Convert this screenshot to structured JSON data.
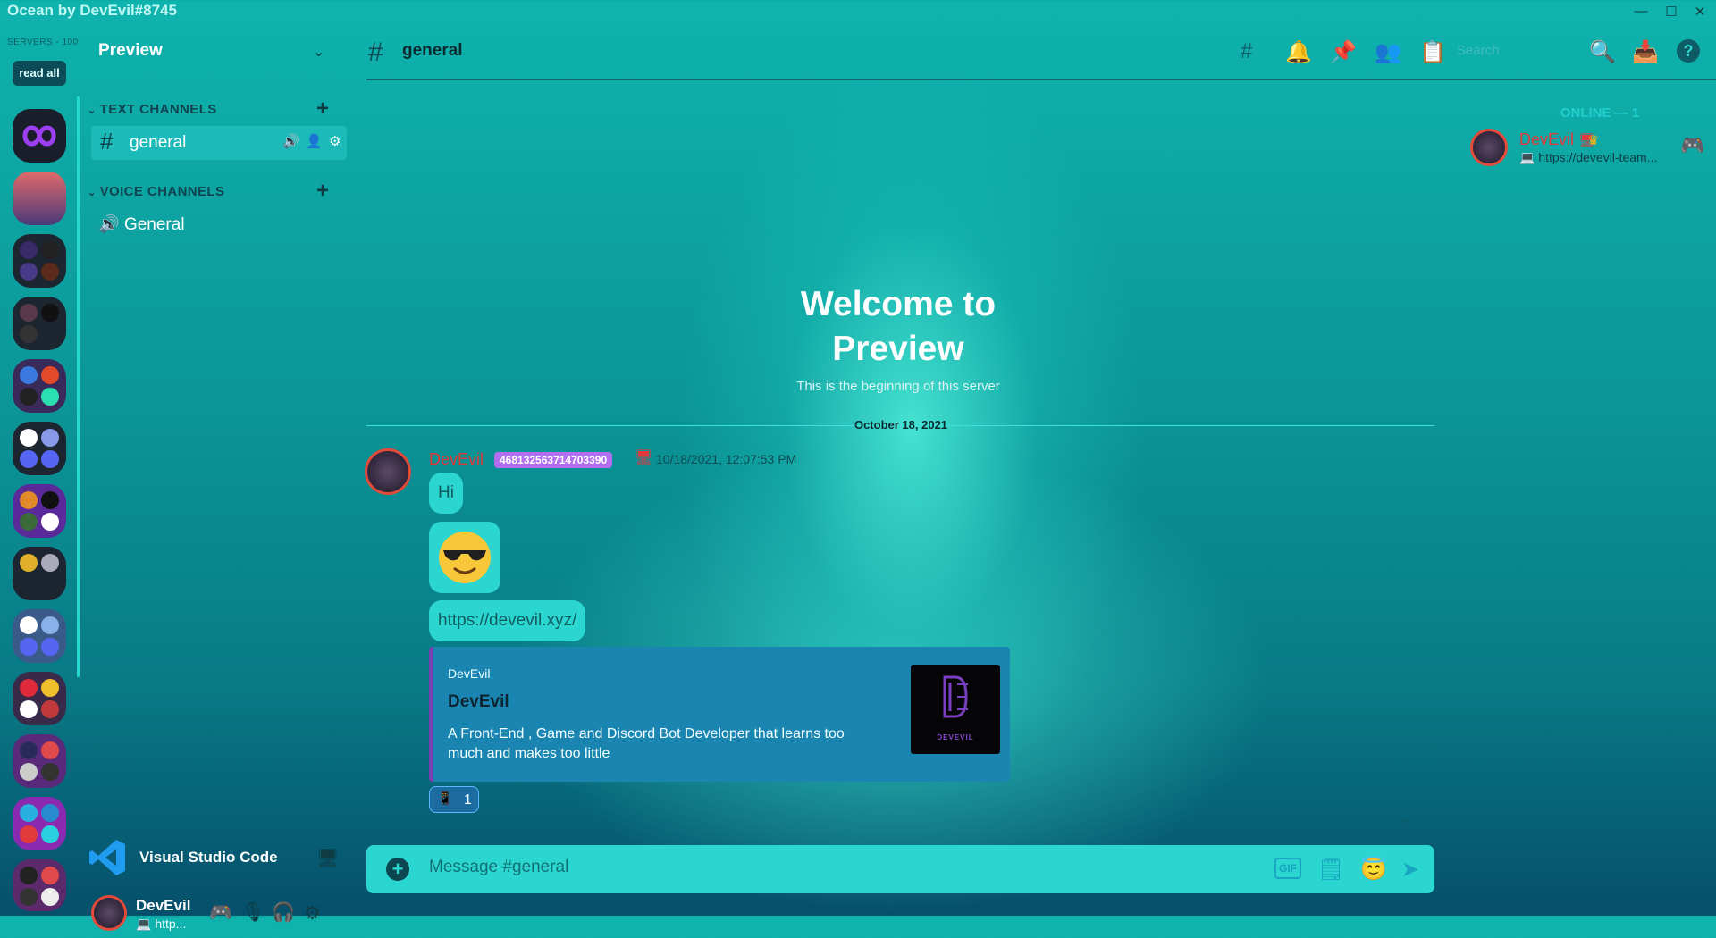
{
  "window": {
    "title": "Ocean by DevEvil#8745",
    "controls": [
      "—",
      "☐",
      "✕"
    ]
  },
  "rail": {
    "servers_count": "SERVERS - 100",
    "read_all": "read all"
  },
  "sidebar": {
    "server_name": "Preview",
    "text_category": "TEXT CHANNELS",
    "voice_category": "VOICE CHANNELS",
    "text_channels": [
      {
        "name": "general"
      }
    ],
    "voice_channels": [
      {
        "name": "General"
      }
    ]
  },
  "activity": {
    "name": "Visual Studio Code"
  },
  "user": {
    "name": "DevEvil",
    "status": "💻 http..."
  },
  "header": {
    "channel": "general",
    "search_placeholder": "Search"
  },
  "welcome": {
    "title_line1": "Welcome to",
    "title_line2": "Preview",
    "subtitle": "This is the beginning of this server"
  },
  "date_divider": "October 18, 2021",
  "message": {
    "author": "DevEvil",
    "badge": "468132563714703390",
    "timestamp": "10/18/2021, 12:07:53 PM",
    "text": "Hi",
    "emoji": "😎",
    "link": "https://devevil.xyz/",
    "embed": {
      "provider": "DevEvil",
      "title": "DevEvil",
      "description": "A Front-End , Game and Discord Bot Developer that learns too much and makes too little",
      "thumb_text": "DEVEVIL"
    },
    "reaction_count": "1"
  },
  "composer": {
    "placeholder": "Message #general",
    "gif_label": "GIF"
  },
  "members": {
    "online_header": "ONLINE — 1",
    "list": [
      {
        "name": "DevEvil",
        "status": "💻 https://devevil-team..."
      }
    ]
  },
  "colors": {
    "accent": "#2ad6cf",
    "author": "#e2383a",
    "badge": "#b36ef0",
    "embed_bg": "#1b85b2"
  }
}
